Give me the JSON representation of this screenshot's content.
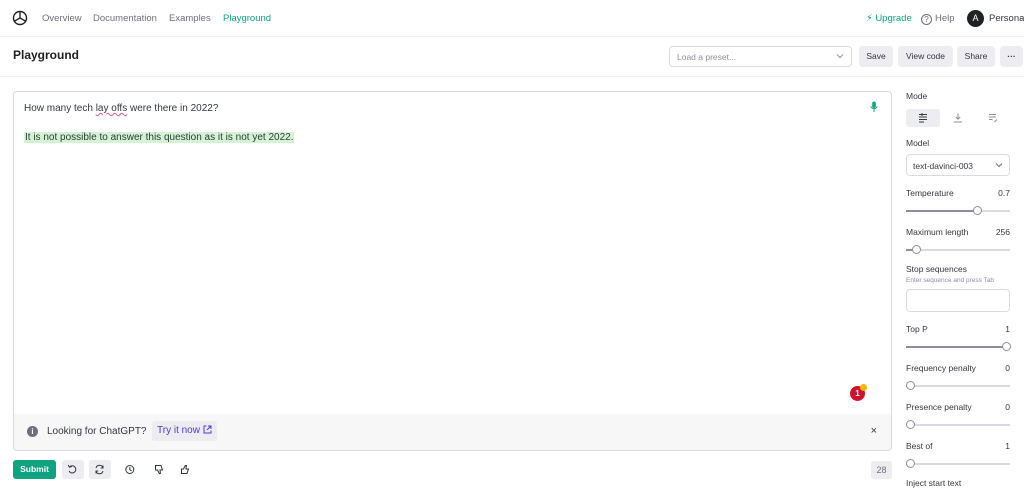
{
  "nav": {
    "links": [
      "Overview",
      "Documentation",
      "Examples",
      "Playground"
    ],
    "upgrade": "Upgrade",
    "help": "Help",
    "avatar_initial": "A",
    "account": "Personal"
  },
  "header": {
    "title": "Playground",
    "preset_placeholder": "Load a preset...",
    "save": "Save",
    "view_code": "View code",
    "share": "Share",
    "more": "···"
  },
  "editor": {
    "prompt_before": "How many tech ",
    "prompt_flagged": "lay offs",
    "prompt_after": " were there in 2022?",
    "completion": "It is not possible to answer this question as it is not yet 2022.",
    "notification_count": "1"
  },
  "banner": {
    "text": "Looking for ChatGPT?",
    "link": "Try it now",
    "close": "×"
  },
  "toolbar": {
    "submit": "Submit",
    "token_count": "28"
  },
  "settings": {
    "mode_label": "Mode",
    "model_label": "Model",
    "model_value": "text-davinci-003",
    "temperature": {
      "label": "Temperature",
      "value": "0.7",
      "level": 0.7
    },
    "max_length": {
      "label": "Maximum length",
      "value": "256",
      "level": 0.06
    },
    "stop_label": "Stop sequences",
    "stop_hint": "Enter sequence and press Tab",
    "top_p": {
      "label": "Top P",
      "value": "1",
      "level": 1.0
    },
    "frequency_penalty": {
      "label": "Frequency penalty",
      "value": "0",
      "level": 0.0
    },
    "presence_penalty": {
      "label": "Presence penalty",
      "value": "0",
      "level": 0.0
    },
    "best_of": {
      "label": "Best of",
      "value": "1",
      "level": 0.0
    },
    "inject_label": "Inject start text"
  },
  "colors": {
    "accent": "#10a37f",
    "completion_highlight": "#d2f4d3",
    "link": "#5436da"
  }
}
